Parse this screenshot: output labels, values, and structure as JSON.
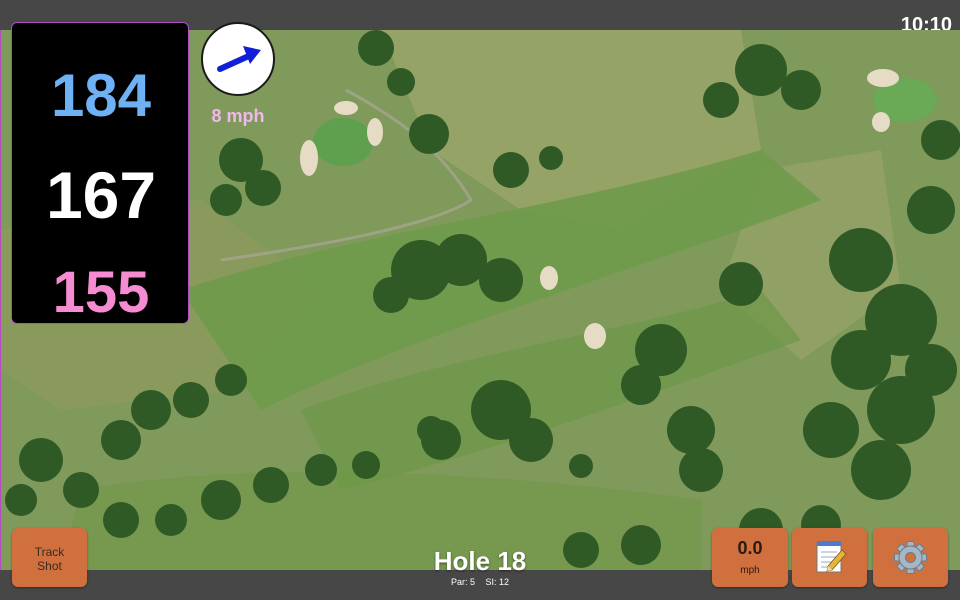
{
  "status": {
    "time": "10:10"
  },
  "distances": {
    "back": "184",
    "middle": "167",
    "front": "155"
  },
  "wind": {
    "speed": "8 mph",
    "icon": "wind-arrow-icon"
  },
  "hole": {
    "title": "Hole 18",
    "par": "Par: 5",
    "si": "SI: 12"
  },
  "buttons": {
    "track_shot": "Track\nShot",
    "speed_value": "0.0",
    "speed_unit": "mph",
    "notes_icon": "notepad-icon",
    "settings_icon": "gear-icon"
  },
  "colors": {
    "back_distance": "#6fb1f5",
    "middle_distance": "#ffffff",
    "front_distance": "#f58bd0",
    "button": "#d0703e",
    "wind_text": "#f2b7ef"
  }
}
